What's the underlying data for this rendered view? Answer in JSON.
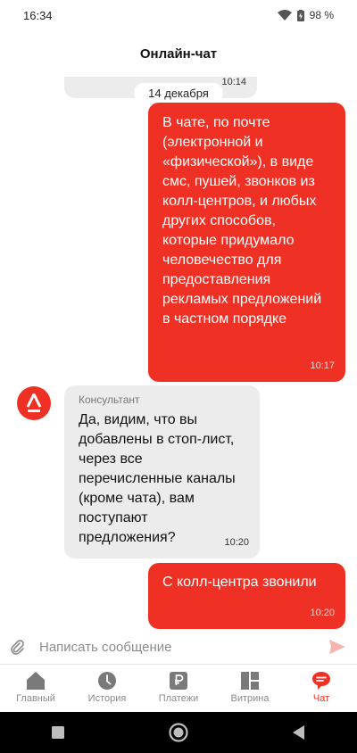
{
  "status_bar": {
    "time": "16:34",
    "battery": "98 %"
  },
  "header": {
    "title": "Онлайн-чат"
  },
  "chat": {
    "top_stub_time": "10:14",
    "date_separator": "14 декабря",
    "messages": [
      {
        "from": "user",
        "text": "В чате, по почте (электронной и «физической»), в виде смс, пушей, звонков из колл-центров, и любых других способов, которые придумало человечество для предоставления рекламых предложений в частном порядке",
        "time": "10:17"
      },
      {
        "from": "agent",
        "sender": "Консультант",
        "text": "Да, видим, что вы добавлены в стоп-лист, через все перечисленные каналы (кроме чата), вам поступают предложения?",
        "time": "10:20"
      },
      {
        "from": "user",
        "text": "С колл-центра звонили",
        "time": "10:20"
      }
    ]
  },
  "composer": {
    "placeholder": "Написать сообщение"
  },
  "tabs": [
    {
      "label": "Главный",
      "icon": "home-icon",
      "active": false
    },
    {
      "label": "История",
      "icon": "clock-icon",
      "active": false
    },
    {
      "label": "Платежи",
      "icon": "ruble-icon",
      "active": false
    },
    {
      "label": "Витрина",
      "icon": "showcase-icon",
      "active": false
    },
    {
      "label": "Чат",
      "icon": "chat-icon",
      "active": true
    }
  ],
  "colors": {
    "accent": "#ee3124",
    "incoming_bubble": "#ececec",
    "inactive_tab": "#8a8a8a"
  }
}
